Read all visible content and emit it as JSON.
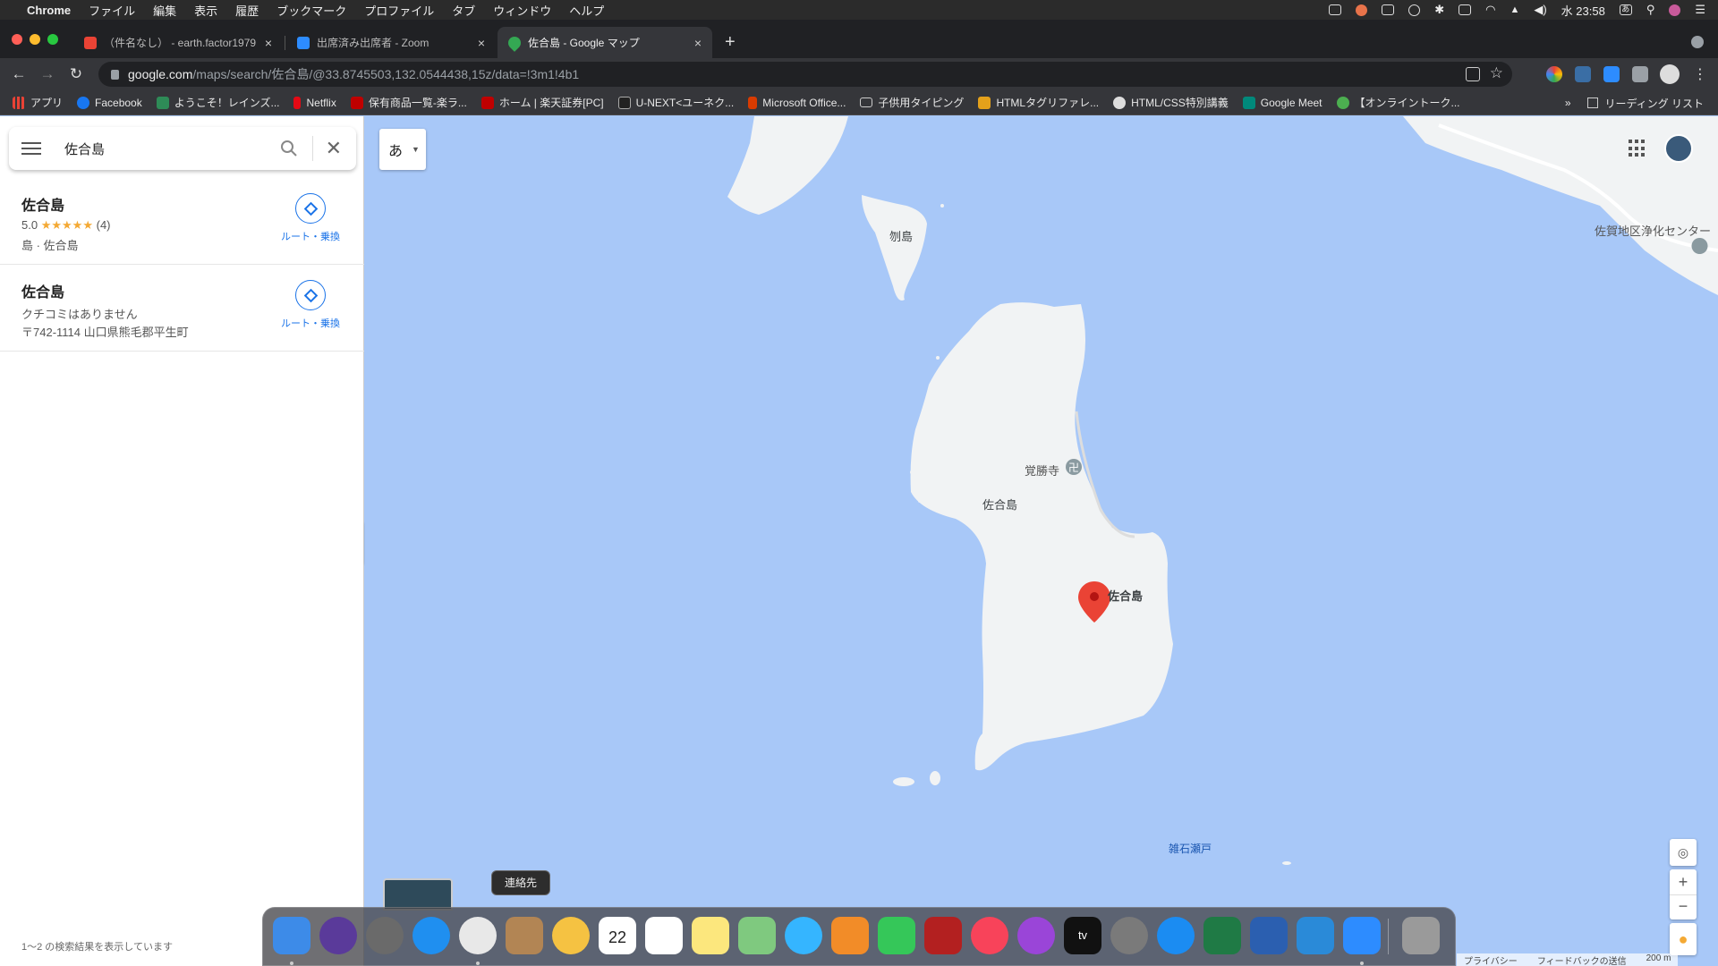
{
  "menubar": {
    "app": "Chrome",
    "items": [
      "ファイル",
      "編集",
      "表示",
      "履歴",
      "ブックマーク",
      "プロファイル",
      "タブ",
      "ウィンドウ",
      "ヘルプ"
    ],
    "clock": "水 23:58",
    "ime": "あ"
  },
  "tabs": [
    {
      "label": "（件名なし） - earth.factor1979",
      "color": "#ea4335"
    },
    {
      "label": "出席済み出席者 - Zoom",
      "color": "#2d8cff"
    },
    {
      "label": "佐合島 - Google マップ",
      "color": "#34a853"
    }
  ],
  "tab_close": "×",
  "new_tab": "+",
  "toolbar": {
    "back": "←",
    "forward": "→",
    "reload": "↻",
    "url_host": "google.com",
    "url_path": "/maps/search/佐合島/@33.8745503,132.0544438,15z/data=!3m1!4b1"
  },
  "bookmarks": [
    {
      "label": "アプリ",
      "color": "#e94235"
    },
    {
      "label": "Facebook",
      "color": "#1877f2"
    },
    {
      "label": "ようこそ！レインズ...",
      "color": "#2e8b57"
    },
    {
      "label": "Netflix",
      "color": "#e50914"
    },
    {
      "label": "保有商品一覧-楽ラ...",
      "color": "#bf0000"
    },
    {
      "label": "ホーム | 楽天証券[PC]",
      "color": "#bf0000"
    },
    {
      "label": "U-NEXT<ユーネク...",
      "color": "#222"
    },
    {
      "label": "Microsoft Office...",
      "color": "#d83b01"
    },
    {
      "label": "子供用タイピング",
      "color": "#888"
    },
    {
      "label": "HTMLタグリファレ...",
      "color": "#e4a11b"
    },
    {
      "label": "HTML/CSS特別講義",
      "color": "#666"
    },
    {
      "label": "Google Meet",
      "color": "#00897b"
    },
    {
      "label": "【オンライントーク...",
      "color": "#4caf50"
    }
  ],
  "bookmarks_more": "»",
  "reading_list": "リーディング リスト",
  "search": {
    "query": "佐合島"
  },
  "results": [
    {
      "name": "佐合島",
      "rating": "5.0",
      "stars": "★★★★★",
      "reviews": "(4)",
      "subtitle": "島 · 佐合島",
      "route_label": "ルート・乗換"
    },
    {
      "name": "佐合島",
      "no_reviews": "クチコミはありません",
      "address": "〒742-1114 山口県熊毛郡平生町",
      "route_label": "ルート・乗換"
    }
  ],
  "result_count": "1〜2 の検索結果を表示しています",
  "map": {
    "labels": {
      "island_north": "刎島",
      "temple": "覚勝寺",
      "island_name": "佐合島",
      "pin_label": "佐合島",
      "strait": "雑石瀬戸",
      "facility": "佐賀地区浄化センター"
    },
    "footer": [
      "プライバシー",
      "フィードバックの送信",
      "200 m"
    ],
    "colors": {
      "water": "#a8c8f8",
      "land": "#f1f3f4",
      "pin": "#ea4335",
      "link": "#1a73e8"
    }
  },
  "dock": {
    "tooltip": "連絡先",
    "apps": [
      {
        "name": "Finder",
        "color": "#3d8be8"
      },
      {
        "name": "Siri",
        "color": "#5a3a9a"
      },
      {
        "name": "Launchpad",
        "color": "#6a6a6a"
      },
      {
        "name": "Safari",
        "color": "#1f8ff0"
      },
      {
        "name": "Chrome",
        "color": "#e8e8e8"
      },
      {
        "name": "Contacts",
        "color": "#b28554"
      },
      {
        "name": "Photos",
        "color": "#f5c242"
      },
      {
        "name": "Calendar",
        "color": "#ffffff"
      },
      {
        "name": "Reminders",
        "color": "#ffffff"
      },
      {
        "name": "Notes",
        "color": "#fce77d"
      },
      {
        "name": "Maps",
        "color": "#7fc97f"
      },
      {
        "name": "Messages",
        "color": "#35b5ff"
      },
      {
        "name": "Books",
        "color": "#f28c28"
      },
      {
        "name": "FaceTime",
        "color": "#35c759"
      },
      {
        "name": "Photo Booth",
        "color": "#b32020"
      },
      {
        "name": "Music",
        "color": "#f8435a"
      },
      {
        "name": "Podcasts",
        "color": "#9a45d8"
      },
      {
        "name": "TV",
        "color": "#111111"
      },
      {
        "name": "System Preferences",
        "color": "#7a7a7a"
      },
      {
        "name": "App Store",
        "color": "#1b8cf2"
      },
      {
        "name": "Excel",
        "color": "#1f7a45"
      },
      {
        "name": "Word",
        "color": "#2b5fb0"
      },
      {
        "name": "VS Code",
        "color": "#2a8ad8"
      },
      {
        "name": "Zoom",
        "color": "#2d8cff"
      },
      {
        "name": "Trash",
        "color": "#9a9a9a"
      }
    ],
    "calendar_day": "22",
    "tv_text": "tv"
  }
}
